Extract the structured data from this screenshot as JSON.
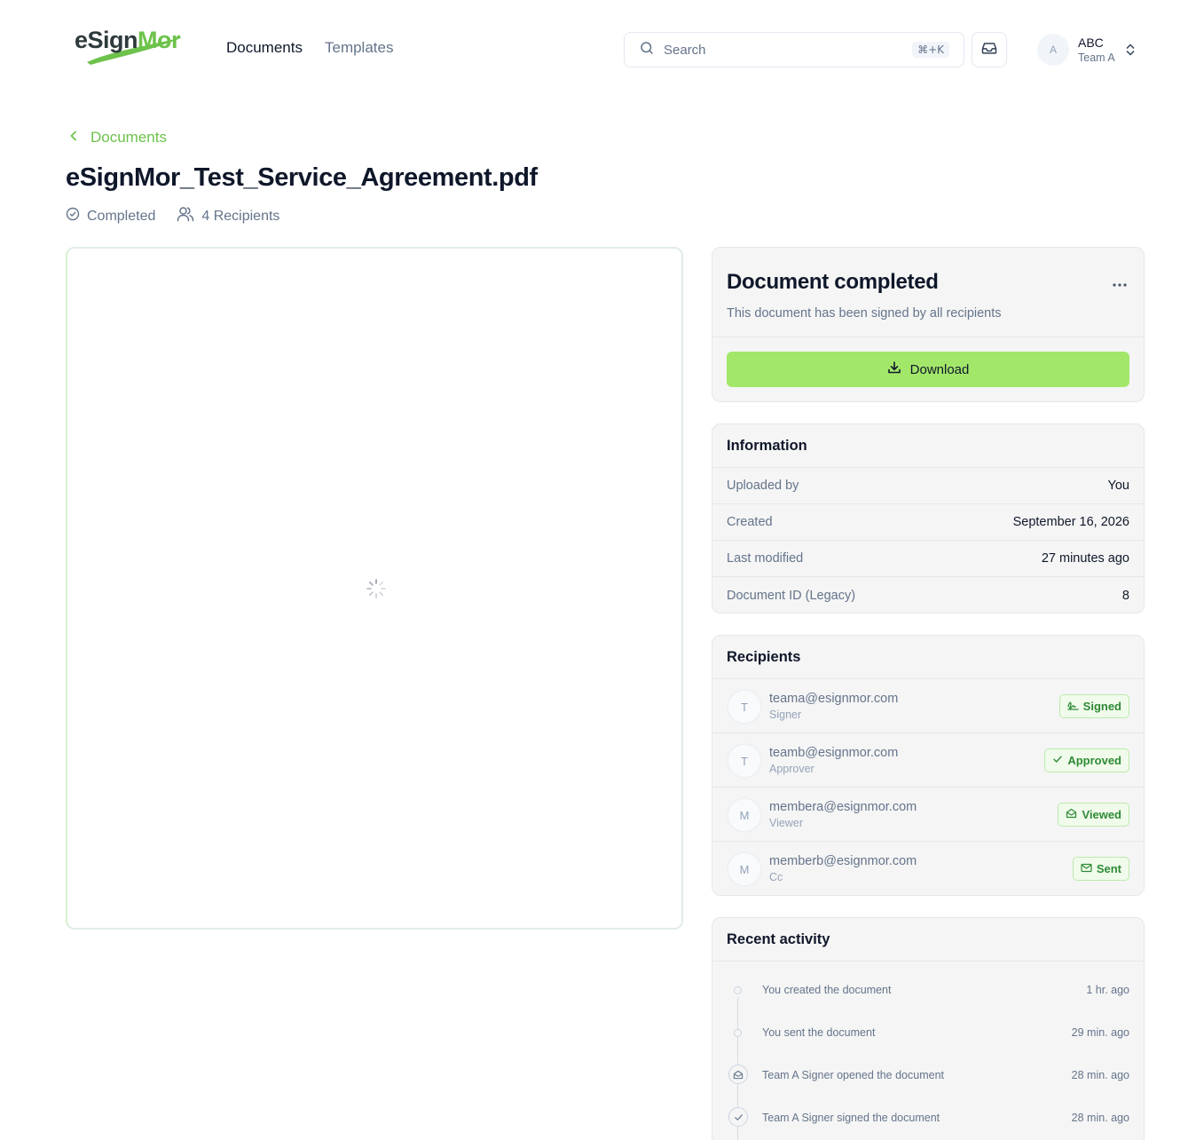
{
  "header": {
    "logo": {
      "part1": "eSign",
      "part2": "Mor"
    },
    "nav": [
      {
        "label": "Documents",
        "active": true
      },
      {
        "label": "Templates",
        "active": false
      }
    ],
    "search": {
      "placeholder": "Search",
      "shortcut": "⌘+K"
    },
    "user": {
      "initial": "A",
      "name": "ABC",
      "team": "Team A"
    }
  },
  "breadcrumb": {
    "label": "Documents"
  },
  "document": {
    "title": "eSignMor_Test_Service_Agreement.pdf",
    "status": "Completed",
    "recipients_count": "4 Recipients"
  },
  "completed_card": {
    "title": "Document completed",
    "description": "This document has been signed by all recipients",
    "download_label": "Download"
  },
  "information": {
    "title": "Information",
    "rows": [
      {
        "label": "Uploaded by",
        "value": "You"
      },
      {
        "label": "Created",
        "value": "September 16, 2026"
      },
      {
        "label": "Last modified",
        "value": "27 minutes ago"
      },
      {
        "label": "Document ID (Legacy)",
        "value": "8"
      }
    ]
  },
  "recipients": {
    "title": "Recipients",
    "items": [
      {
        "initial": "T",
        "email": "teama@esignmor.com",
        "role": "Signer",
        "status": "Signed",
        "icon": "signature-icon"
      },
      {
        "initial": "T",
        "email": "teamb@esignmor.com",
        "role": "Approver",
        "status": "Approved",
        "icon": "check-icon"
      },
      {
        "initial": "M",
        "email": "membera@esignmor.com",
        "role": "Viewer",
        "status": "Viewed",
        "icon": "mail-open-icon"
      },
      {
        "initial": "M",
        "email": "memberb@esignmor.com",
        "role": "Cc",
        "status": "Sent",
        "icon": "mail-icon"
      }
    ]
  },
  "activity": {
    "title": "Recent activity",
    "items": [
      {
        "text": "You created the document",
        "time": "1 hr. ago",
        "icon": "dot"
      },
      {
        "text": "You sent the document",
        "time": "29 min. ago",
        "icon": "dot"
      },
      {
        "text": "Team A Signer opened the document",
        "time": "28 min. ago",
        "icon": "mail-open-icon"
      },
      {
        "text": "Team A Signer signed the document",
        "time": "28 min. ago",
        "icon": "check-icon"
      }
    ]
  },
  "colors": {
    "brand_green": "#6cc24a",
    "download_button": "#a3e76a",
    "badge_text": "#2e8a35"
  }
}
